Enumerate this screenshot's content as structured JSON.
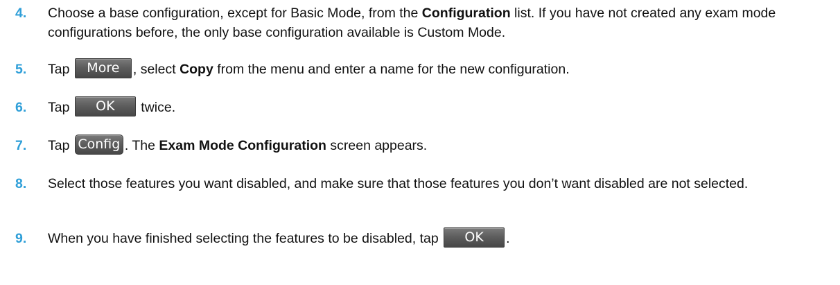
{
  "accent_color": "#2f9fd8",
  "steps": [
    {
      "number": "4.",
      "parts": [
        "Choose a base configuration, except for Basic Mode, from the ",
        "Configuration",
        " list. If you have not created any exam mode configurations before, the only base configuration available is Custom Mode."
      ]
    },
    {
      "number": "5.",
      "parts": [
        "Tap ",
        "More",
        ", select ",
        "Copy",
        " from the menu and enter a name for the new configuration."
      ]
    },
    {
      "number": "6.",
      "parts": [
        "Tap ",
        "OK",
        " twice."
      ]
    },
    {
      "number": "7.",
      "parts": [
        "Tap ",
        "Config",
        ". The ",
        "Exam Mode Configuration",
        " screen appears."
      ]
    },
    {
      "number": "8.",
      "parts": [
        "Select those features you want disabled, and make sure that those features you don’t want disabled are not selected."
      ]
    },
    {
      "number": "9.",
      "parts": [
        "When you have finished selecting the features to be disabled, tap ",
        "OK",
        "."
      ]
    }
  ]
}
